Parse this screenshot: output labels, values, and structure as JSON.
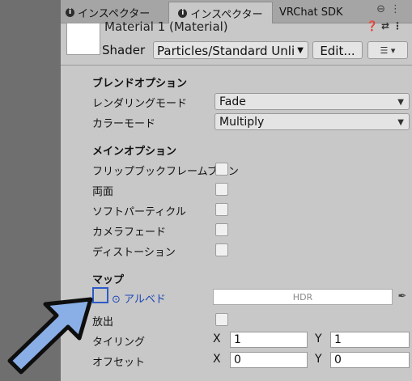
{
  "tabs": [
    {
      "label": "インスペクター",
      "icon": "info-icon",
      "active": false
    },
    {
      "label": "インスペクター",
      "icon": "info-icon",
      "active": true
    },
    {
      "label": "VRChat SDK",
      "active": false
    }
  ],
  "tab_actions": "⊖ ⋮",
  "material": {
    "title": "Material 1 (Material)",
    "shader_label": "Shader",
    "shader_value": "Particles/Standard Unli",
    "edit_label": "Edit...",
    "list_label": "☰ ▾"
  },
  "header_icons": "❓ ⇄ ⋮",
  "blend": {
    "title": "ブレンドオプション",
    "render_mode_label": "レンダリングモード",
    "render_mode_value": "Fade",
    "color_mode_label": "カラーモード",
    "color_mode_value": "Multiply"
  },
  "main": {
    "title": "メインオプション",
    "items": [
      {
        "label": "フリップブックフレームブレン"
      },
      {
        "label": "両面"
      },
      {
        "label": "ソフトパーティクル"
      },
      {
        "label": "カメラフェード"
      },
      {
        "label": "ディストーション"
      }
    ]
  },
  "maps": {
    "title": "マップ",
    "albedo_label": "⊙ アルベド",
    "hdr_label": "HDR",
    "emission_label": "放出",
    "tiling_label": "タイリング",
    "offset_label": "オフセット",
    "x_label": "X",
    "y_label": "Y",
    "tiling_x": "1",
    "tiling_y": "1",
    "offset_x": "0",
    "offset_y": "0"
  },
  "colors": {
    "accent_blue": "#2c5bc8",
    "arrow_fill": "#8aaee6",
    "panel_bg": "#c8c8c8"
  }
}
